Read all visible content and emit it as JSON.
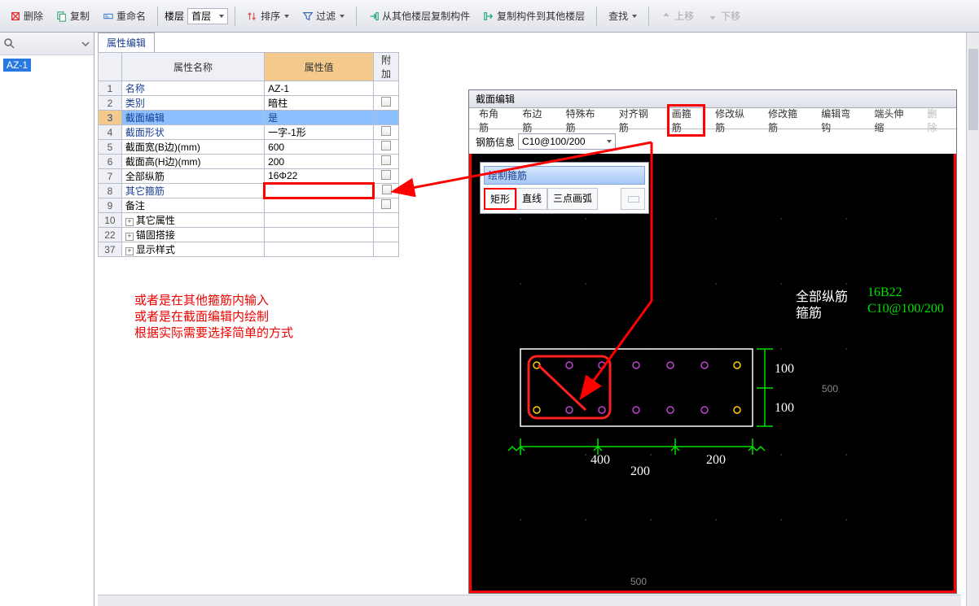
{
  "toolbar": {
    "delete": "删除",
    "copy": "复制",
    "rename": "重命名",
    "floor_label": "楼层",
    "floor_value": "首层",
    "sort": "排序",
    "filter": "过滤",
    "copy_from": "从其他楼层复制构件",
    "copy_to": "复制构件到其他楼层",
    "find": "查找",
    "moveup": "上移",
    "movedown": "下移"
  },
  "sidebar": {
    "item": "AZ-1"
  },
  "panel": {
    "tab": "属性编辑",
    "head_name": "属性名称",
    "head_value": "属性值",
    "head_extra": "附加",
    "rows": [
      {
        "n": "1",
        "name": "名称",
        "val": "AZ-1",
        "link": true,
        "chk": false
      },
      {
        "n": "2",
        "name": "类别",
        "val": "暗柱",
        "link": true,
        "chk": true
      },
      {
        "n": "3",
        "name": "截面编辑",
        "val": "是",
        "link": true,
        "sel": true
      },
      {
        "n": "4",
        "name": "截面形状",
        "val": "一字-1形",
        "link": true,
        "chk": true
      },
      {
        "n": "5",
        "name": "截面宽(B边)(mm)",
        "val": "600",
        "chk": true
      },
      {
        "n": "6",
        "name": "截面高(H边)(mm)",
        "val": "200",
        "chk": true
      },
      {
        "n": "7",
        "name": "全部纵筋",
        "val": "16Φ22",
        "chk": true
      },
      {
        "n": "8",
        "name": "其它箍筋",
        "val": "",
        "link": true,
        "chk": true,
        "hl": true
      },
      {
        "n": "9",
        "name": "备注",
        "val": "",
        "chk": true
      },
      {
        "n": "10",
        "name": "其它属性",
        "expand": true
      },
      {
        "n": "22",
        "name": "锚固搭接",
        "expand": true
      },
      {
        "n": "37",
        "name": "显示样式",
        "expand": true
      }
    ]
  },
  "note": {
    "l1": "或者是在其他箍筋内输入",
    "l2": "或者是在截面编辑内绘制",
    "l3": "根据实际需要选择简单的方式"
  },
  "drawing": {
    "title": "截面编辑",
    "tabs": [
      "布角筋",
      "布边筋",
      "特殊布筋",
      "对齐钢筋",
      "画箍筋",
      "修改纵筋",
      "修改箍筋",
      "编辑弯钩",
      "端头伸缩",
      "删除"
    ],
    "active_tab": 4,
    "steel_label": "钢筋信息",
    "steel_value": "C10@100/200",
    "popup_title": "绘制箍筋",
    "popup_opts": [
      "矩形",
      "直线",
      "三点画弧"
    ],
    "popup_sel": 0,
    "dim_400": "400",
    "dim_200a": "200",
    "dim_200b": "200",
    "dim_100a": "100",
    "dim_100b": "100",
    "dim_500a": "500",
    "dim_500b": "500",
    "label_all": "全部纵筋",
    "label_hoop": "箍筋",
    "val_all": "16B22",
    "val_hoop": "C10@100/200"
  }
}
